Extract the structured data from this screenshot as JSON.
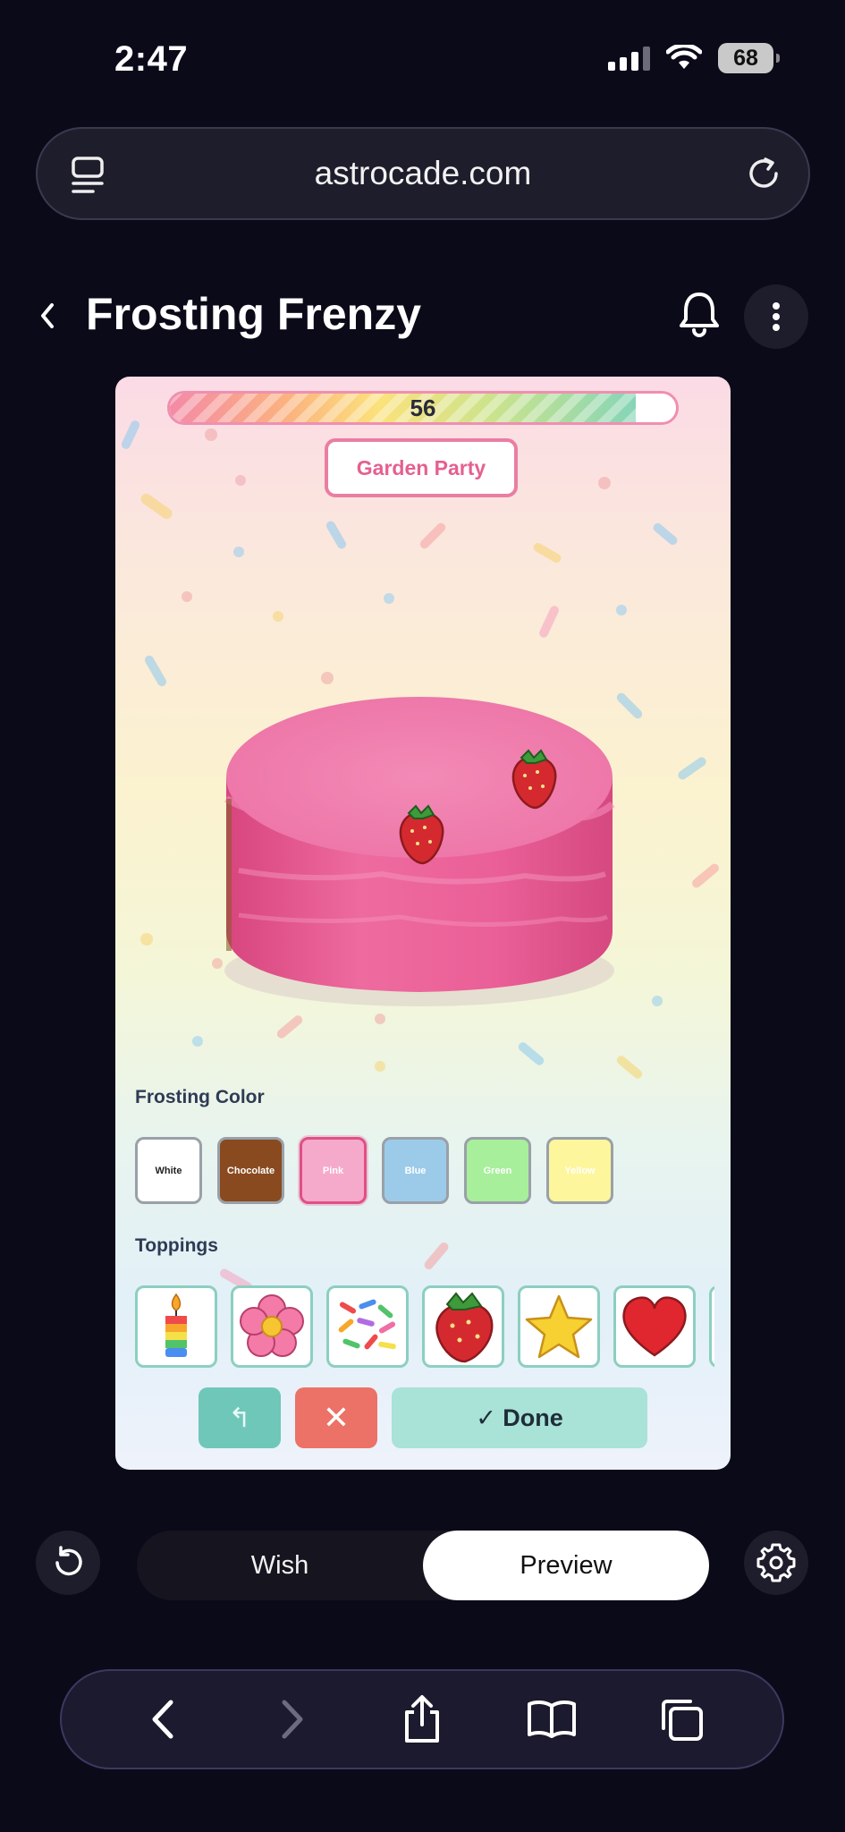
{
  "status_bar": {
    "time": "2:47",
    "battery": "68"
  },
  "browser": {
    "url": "astrocade.com"
  },
  "header": {
    "title": "Frosting Frenzy"
  },
  "game": {
    "progress": {
      "value": "56",
      "fraction": 0.92
    },
    "event_name": "Garden Party",
    "frosting_label": "Frosting Color",
    "frosting_colors": [
      {
        "label": "White",
        "color": "#ffffff",
        "text": "#222222"
      },
      {
        "label": "Chocolate",
        "color": "#8a4a1f",
        "text": "#ffffff"
      },
      {
        "label": "Pink",
        "color": "#f6aacb",
        "text": "#ffffff"
      },
      {
        "label": "Blue",
        "color": "#9ccbea",
        "text": "#ffffff"
      },
      {
        "label": "Green",
        "color": "#a8ef9b",
        "text": "#ffffff"
      },
      {
        "label": "Yellow",
        "color": "#fdf69c",
        "text": "#ffffff"
      }
    ],
    "selected_frosting": "Pink",
    "toppings_label": "Toppings",
    "toppings": [
      "candle-icon",
      "flower-icon",
      "sprinkles-icon",
      "strawberry-icon",
      "star-icon",
      "heart-icon",
      "more-topping-icon"
    ],
    "actions": {
      "undo": "↰",
      "clear": "✕",
      "done": "✓ Done"
    }
  },
  "mode_toggle": {
    "wish": "Wish",
    "preview": "Preview",
    "active": "Preview"
  },
  "colors": {
    "background": "#0b0a19",
    "frosting_pink": "#f07aa8",
    "done_button": "#a9e2d6",
    "clear_button": "#ec7167",
    "undo_button": "#6fc7ba"
  }
}
